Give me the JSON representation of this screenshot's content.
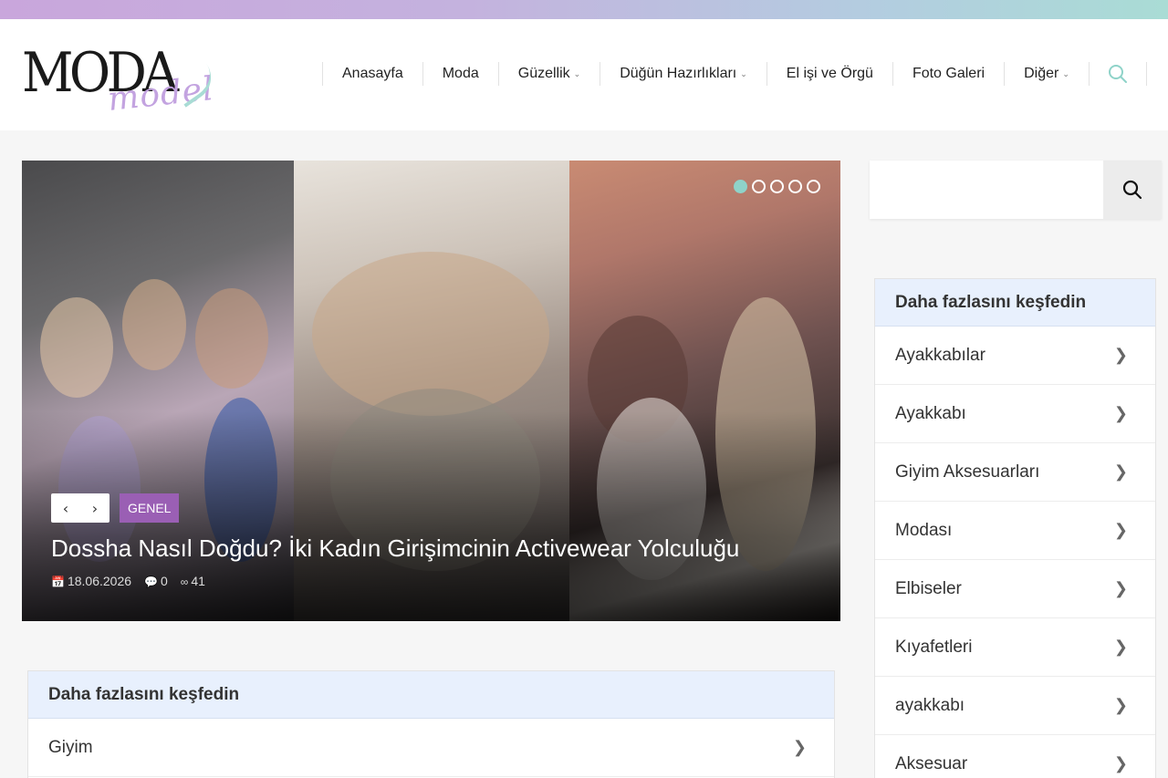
{
  "brand": {
    "logo_main": "MODA",
    "logo_sub": "model"
  },
  "nav": {
    "items": [
      {
        "label": "Anasayfa",
        "dropdown": false
      },
      {
        "label": "Moda",
        "dropdown": false
      },
      {
        "label": "Güzellik",
        "dropdown": true
      },
      {
        "label": "Düğün Hazırlıkları",
        "dropdown": true
      },
      {
        "label": "El işi ve Örgü",
        "dropdown": false
      },
      {
        "label": "Foto Galeri",
        "dropdown": false
      },
      {
        "label": "Diğer",
        "dropdown": true
      }
    ],
    "search_icon": "search-icon"
  },
  "slider": {
    "category": "GENEL",
    "title": "Dossha Nasıl Doğdu? İki Kadın Girişimcinin Activewear Yolculuğu",
    "date": "18.06.2026",
    "comments": "0",
    "views": "41",
    "dots": 5,
    "active_dot": 0
  },
  "sidebar": {
    "search_placeholder": "",
    "discover_title": "Daha fazlasını keşfedin",
    "items": [
      "Ayakkabılar",
      "Ayakkabı",
      "Giyim Aksesuarları",
      "Modası",
      "Elbiseler",
      "Kıyafetleri",
      "ayakkabı",
      "Aksesuar"
    ]
  },
  "main_discover": {
    "title": "Daha fazlasını keşfedin",
    "items": [
      "Giyim"
    ]
  },
  "colors": {
    "accent": "#8fd3c9",
    "badge": "#9a5fb4",
    "panel_head": "#e8f0fd"
  }
}
